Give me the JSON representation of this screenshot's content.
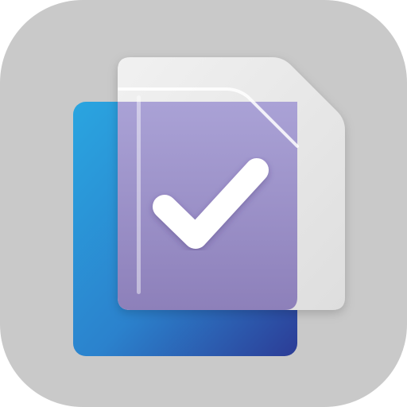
{
  "app_icon": {
    "icon_name": "document-check-icon",
    "colors": {
      "tile_background": "#c9c9c9",
      "back_document_gradient_start": "#2aa5e0",
      "back_document_gradient_end": "#2c3c96",
      "front_document_frost": "#e7e7e7",
      "front_document_tint": "#9b8dc3",
      "checkmark": "#ffffff"
    }
  }
}
